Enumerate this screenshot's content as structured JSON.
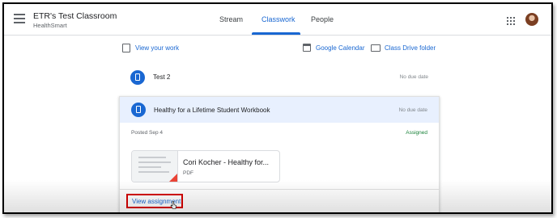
{
  "header": {
    "class_title": "ETR's Test Classroom",
    "class_subtitle": "HealthSmart",
    "tabs": [
      {
        "label": "Stream",
        "active": false
      },
      {
        "label": "Classwork",
        "active": true
      },
      {
        "label": "People",
        "active": false
      }
    ]
  },
  "links": {
    "view_your_work": "View your work",
    "google_calendar": "Google Calendar",
    "class_drive_folder": "Class Drive folder"
  },
  "items": [
    {
      "title": "Test 2",
      "due": "No due date"
    },
    {
      "title": "Healthy for a Lifetime Student Workbook",
      "due": "No due date",
      "posted": "Posted Sep 4",
      "status": "Assigned",
      "attachment": {
        "title": "Cori Kocher - Healthy for...",
        "type": "PDF"
      },
      "action_label": "View assignment"
    }
  ],
  "colors": {
    "accent": "#1967d2",
    "highlight_box": "#d50000",
    "status_assigned": "#188038"
  }
}
